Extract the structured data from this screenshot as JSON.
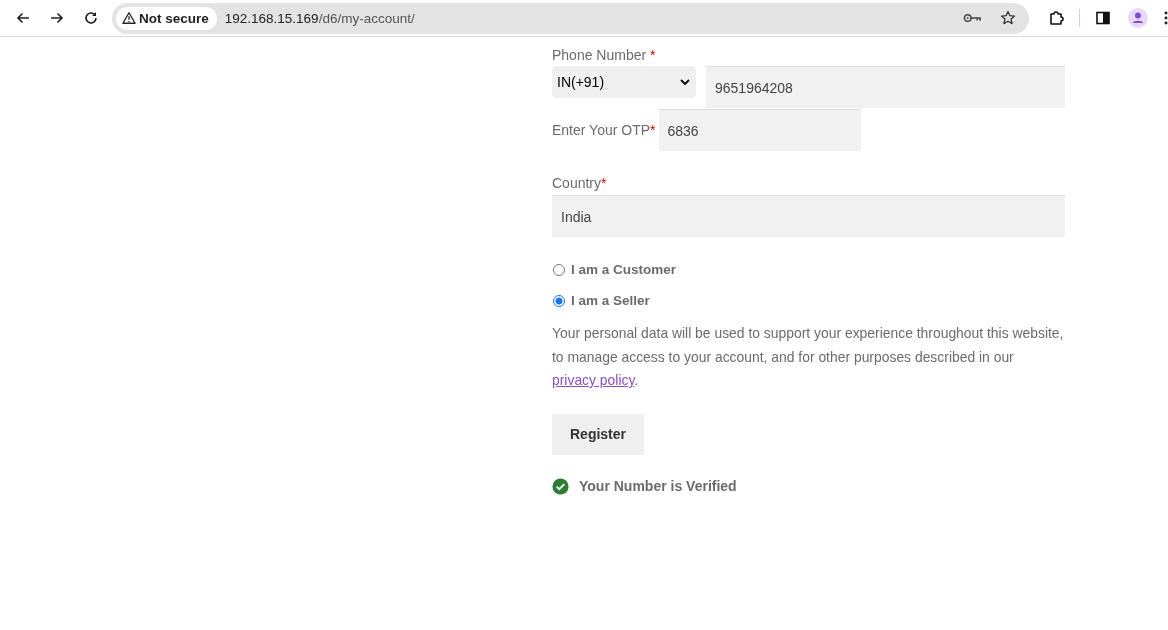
{
  "browser": {
    "security_label": "Not secure",
    "url_host": "192.168.15.169",
    "url_path": "/d6/my-account/"
  },
  "form": {
    "phone": {
      "label": "Phone Number",
      "required_mark": "*",
      "country_code": "IN(+91)",
      "value": "9651964208"
    },
    "otp": {
      "label": "Enter Your OTP",
      "required_mark": "*",
      "value": "6836"
    },
    "country": {
      "label": "Country",
      "required_mark": "*",
      "value": "India"
    },
    "roles": [
      {
        "label": "I am a Customer",
        "selected": false
      },
      {
        "label": "I am a Seller",
        "selected": true
      }
    ],
    "privacy_notice": {
      "text_before": "Your personal data will be used to support your experience throughout this website, to manage access to your account, and for other purposes described in our ",
      "link": "privacy policy",
      "text_after": "."
    },
    "submit": "Register",
    "status": "Your Number is Verified"
  }
}
